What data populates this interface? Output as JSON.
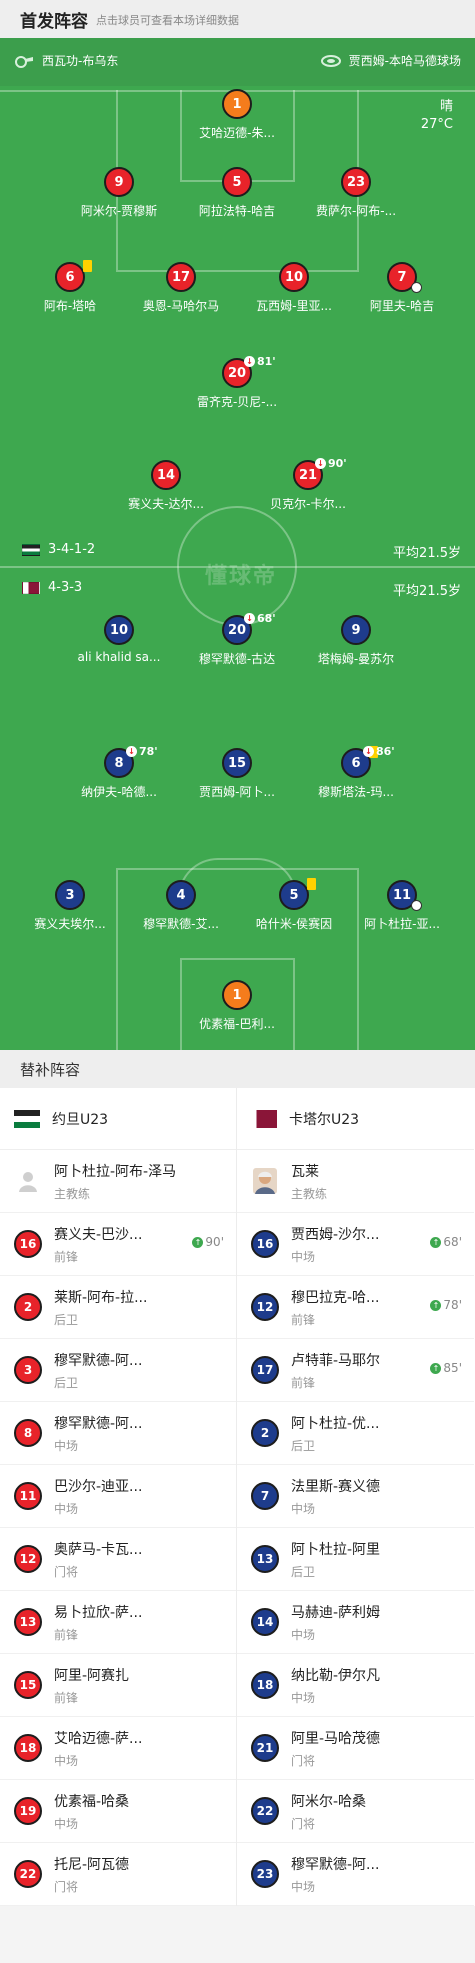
{
  "header": {
    "title": "首发阵容",
    "hint": "点击球员可查看本场详细数据"
  },
  "pitch": {
    "referee": "西瓦功-布乌东",
    "stadium": "贾西姆-本哈马德球场",
    "weather": {
      "condition": "晴",
      "temp": "27°C"
    },
    "watermark": "懂球帝",
    "home": {
      "formation": "3-4-1-2",
      "avg_age": "平均21.5岁"
    },
    "away": {
      "formation": "4-3-3",
      "avg_age": "平均21.5岁"
    },
    "home_players": [
      {
        "num": "1",
        "name": "艾哈迈德-朱...",
        "color": "orange"
      },
      {
        "num": "9",
        "name": "阿米尔-贾穆斯",
        "color": "red"
      },
      {
        "num": "5",
        "name": "阿拉法特-哈吉",
        "color": "red"
      },
      {
        "num": "23",
        "name": "费萨尔-阿布-...",
        "color": "red"
      },
      {
        "num": "6",
        "name": "阿布-塔哈",
        "color": "red",
        "yellow": true
      },
      {
        "num": "17",
        "name": "奥恩-马哈尔马",
        "color": "red"
      },
      {
        "num": "10",
        "name": "瓦西姆-里亚...",
        "color": "red"
      },
      {
        "num": "7",
        "name": "阿里夫-哈吉",
        "color": "red",
        "goal": true
      },
      {
        "num": "20",
        "name": "雷齐克-贝尼-...",
        "color": "red",
        "sub": "81'"
      },
      {
        "num": "14",
        "name": "赛义夫-达尔...",
        "color": "red"
      },
      {
        "num": "21",
        "name": "贝克尔-卡尔...",
        "color": "red",
        "sub": "90'"
      }
    ],
    "away_players": [
      {
        "num": "10",
        "name": "ali khalid sa...",
        "color": "blue"
      },
      {
        "num": "20",
        "name": "穆罕默德-古达",
        "color": "blue",
        "sub": "68'"
      },
      {
        "num": "9",
        "name": "塔梅姆-曼苏尔",
        "color": "blue"
      },
      {
        "num": "8",
        "name": "纳伊夫-哈德...",
        "color": "blue",
        "sub": "78'"
      },
      {
        "num": "15",
        "name": "贾西姆-阿卜...",
        "color": "blue"
      },
      {
        "num": "6",
        "name": "穆斯塔法-玛...",
        "color": "blue",
        "yellow": true,
        "sub": "86'"
      },
      {
        "num": "3",
        "name": "赛义夫埃尔...",
        "color": "blue"
      },
      {
        "num": "4",
        "name": "穆罕默德-艾...",
        "color": "blue"
      },
      {
        "num": "5",
        "name": "哈什米-侯赛因",
        "color": "blue",
        "yellow": true
      },
      {
        "num": "11",
        "name": "阿卜杜拉-亚...",
        "color": "blue",
        "goal": true
      },
      {
        "num": "1",
        "name": "优素福-巴利...",
        "color": "orange"
      }
    ]
  },
  "subs": {
    "title": "替补阵容",
    "home": {
      "team": "约旦U23",
      "coach": {
        "name": "阿卜杜拉-阿布-泽马",
        "role": "主教练"
      },
      "players": [
        {
          "num": "16",
          "name": "赛义夫-巴沙...",
          "pos": "前锋",
          "sub": "90'"
        },
        {
          "num": "2",
          "name": "莱斯-阿布-拉...",
          "pos": "后卫"
        },
        {
          "num": "3",
          "name": "穆罕默德-阿...",
          "pos": "后卫"
        },
        {
          "num": "8",
          "name": "穆罕默德-阿...",
          "pos": "中场"
        },
        {
          "num": "11",
          "name": "巴沙尔-迪亚...",
          "pos": "中场"
        },
        {
          "num": "12",
          "name": "奥萨马-卡瓦...",
          "pos": "门将"
        },
        {
          "num": "13",
          "name": "易卜拉欣-萨...",
          "pos": "前锋"
        },
        {
          "num": "15",
          "name": "阿里-阿赛扎",
          "pos": "前锋"
        },
        {
          "num": "18",
          "name": "艾哈迈德-萨...",
          "pos": "中场"
        },
        {
          "num": "19",
          "name": "优素福-哈桑",
          "pos": "中场"
        },
        {
          "num": "22",
          "name": "托尼-阿瓦德",
          "pos": "门将"
        }
      ]
    },
    "away": {
      "team": "卡塔尔U23",
      "coach": {
        "name": "瓦莱",
        "role": "主教练"
      },
      "players": [
        {
          "num": "16",
          "name": "贾西姆-沙尔...",
          "pos": "中场",
          "sub": "68'"
        },
        {
          "num": "12",
          "name": "穆巴拉克-哈...",
          "pos": "前锋",
          "sub": "78'"
        },
        {
          "num": "17",
          "name": "卢特菲-马耶尔",
          "pos": "前锋",
          "sub": "85'"
        },
        {
          "num": "2",
          "name": "阿卜杜拉-优...",
          "pos": "后卫"
        },
        {
          "num": "7",
          "name": "法里斯-赛义德",
          "pos": "中场"
        },
        {
          "num": "13",
          "name": "阿卜杜拉-阿里",
          "pos": "后卫"
        },
        {
          "num": "14",
          "name": "马赫迪-萨利姆",
          "pos": "中场"
        },
        {
          "num": "18",
          "name": "纳比勒-伊尔凡",
          "pos": "中场"
        },
        {
          "num": "21",
          "name": "阿里-马哈茂德",
          "pos": "门将"
        },
        {
          "num": "22",
          "name": "阿米尔-哈桑",
          "pos": "门将"
        },
        {
          "num": "23",
          "name": "穆罕默德-阿...",
          "pos": "中场"
        }
      ]
    }
  }
}
